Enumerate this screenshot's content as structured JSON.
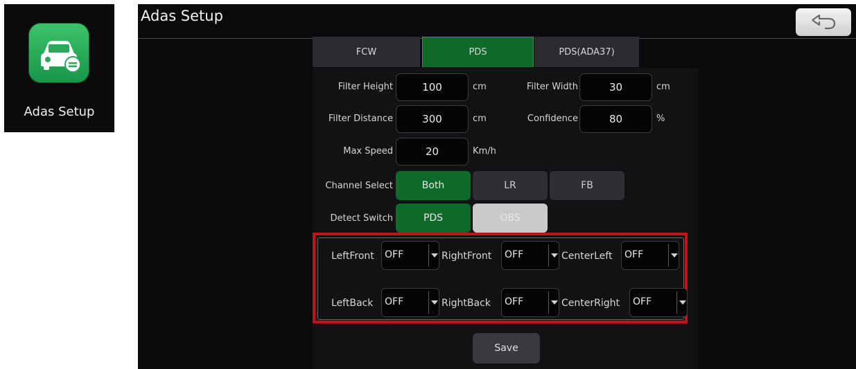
{
  "app_tile": {
    "label": "Adas Setup",
    "icon": "car-icon"
  },
  "header": {
    "title": "Adas Setup",
    "back_icon": "back-arrow-icon"
  },
  "tabs": [
    {
      "label": "FCW",
      "active": false
    },
    {
      "label": "PDS",
      "active": true
    },
    {
      "label": "PDS(ADA37)",
      "active": false
    }
  ],
  "fields": {
    "filter_height": {
      "label": "Filter Height",
      "value": "100",
      "unit": "cm"
    },
    "filter_width": {
      "label": "Filter Width",
      "value": "30",
      "unit": "cm"
    },
    "filter_distance": {
      "label": "Filter Distance",
      "value": "300",
      "unit": "cm"
    },
    "confidence": {
      "label": "Confidence",
      "value": "80",
      "unit": "%"
    },
    "max_speed": {
      "label": "Max Speed",
      "value": "20",
      "unit": "Km/h"
    }
  },
  "channel_select": {
    "label": "Channel Select",
    "options": [
      "Both",
      "LR",
      "FB"
    ],
    "selected": "Both"
  },
  "detect_switch": {
    "label": "Detect Switch",
    "options": [
      "PDS",
      "OBS"
    ],
    "selected": "PDS"
  },
  "sensors": {
    "left_front": {
      "label": "LeftFront",
      "value": "OFF"
    },
    "right_front": {
      "label": "RightFront",
      "value": "OFF"
    },
    "center_left": {
      "label": "CenterLeft",
      "value": "OFF"
    },
    "left_back": {
      "label": "LeftBack",
      "value": "OFF"
    },
    "right_back": {
      "label": "RightBack",
      "value": "OFF"
    },
    "center_right": {
      "label": "CenterRight",
      "value": "OFF"
    }
  },
  "save_label": "Save",
  "colors": {
    "active_green": "#0d6a2a",
    "highlight_red": "#c0141a"
  }
}
